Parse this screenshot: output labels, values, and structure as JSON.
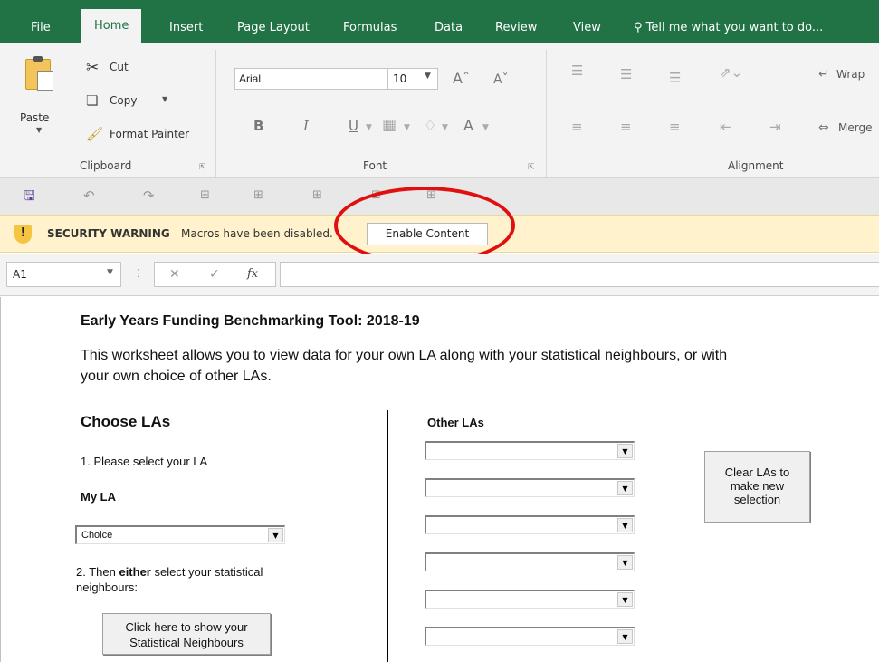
{
  "tabs": [
    "File",
    "Home",
    "Insert",
    "Page Layout",
    "Formulas",
    "Data",
    "Review",
    "View"
  ],
  "tell_me": "Tell me what you want to do...",
  "clipboard": {
    "paste": "Paste",
    "cut": "Cut",
    "copy": "Copy",
    "format_painter": "Format Painter",
    "group_label": "Clipboard"
  },
  "font": {
    "name": "Arial",
    "size": "10",
    "bold": "B",
    "italic": "I",
    "underline": "U",
    "group_label": "Font"
  },
  "alignment": {
    "wrap": "Wrap",
    "merge": "Merge",
    "group_label": "Alignment"
  },
  "security": {
    "title": "SECURITY WARNING",
    "message": "Macros have been disabled.",
    "button": "Enable Content"
  },
  "formula_bar": {
    "name_box": "A1",
    "fx": "fx",
    "formula": ""
  },
  "sheet": {
    "title": "Early Years Funding Benchmarking Tool: 2018-19",
    "description_line1": "This worksheet allows you to view data for your own LA along with your statistical neighbours, or with",
    "description_line2": "your own choice of other LAs.",
    "choose_las": "Choose LAs",
    "step1": "1. Please select your LA",
    "my_la": "My LA",
    "my_la_value": "Choice",
    "step2_prefix": "2. Then ",
    "step2_bold": "either",
    "step2_suffix": " select your statistical",
    "step2_line2": "neighbours:",
    "show_sn_line1": "Click here to show your",
    "show_sn_line2": "Statistical Neighbours",
    "other_las": "Other LAs",
    "clear_line1": "Clear LAs to",
    "clear_line2": "make new",
    "clear_line3": "selection"
  },
  "colors": {
    "excel_green": "#217346",
    "warning_bar": "#fff2cc",
    "highlight_oval": "#e01010"
  }
}
